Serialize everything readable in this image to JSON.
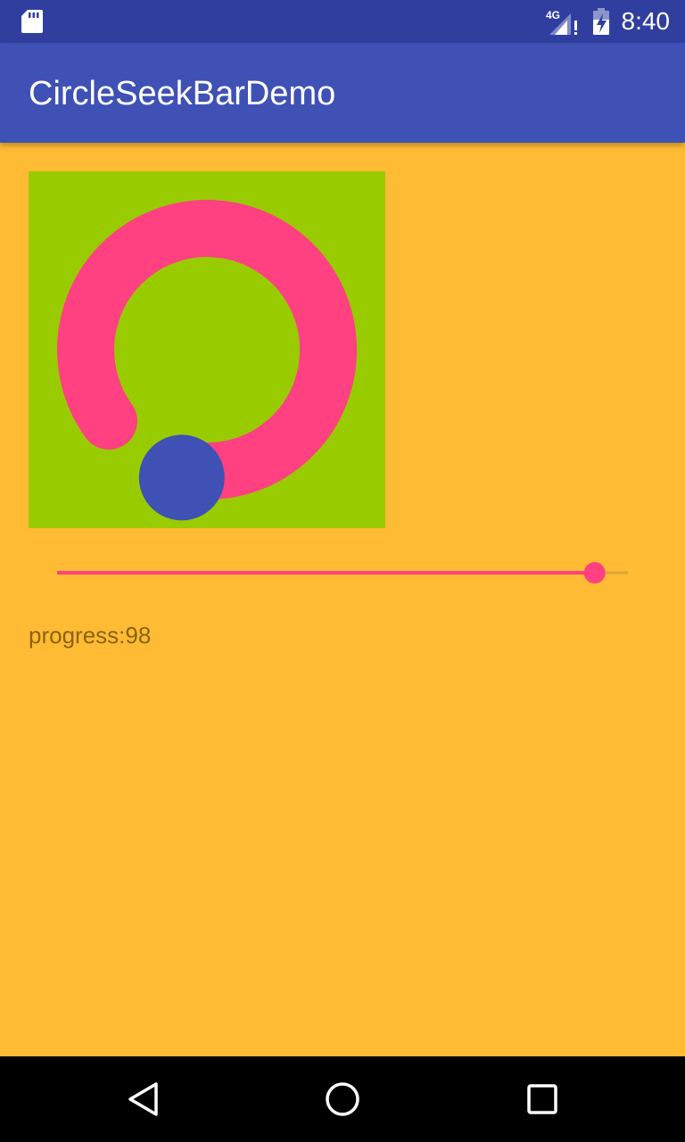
{
  "status_bar": {
    "time": "8:40",
    "network": "4G",
    "icons": [
      "sd-card-icon",
      "cellular-signal-icon",
      "battery-icon"
    ]
  },
  "app_bar": {
    "title": "CircleSeekBarDemo"
  },
  "circle_seekbar": {
    "progress": 98,
    "max": 100,
    "colors": {
      "background": "#99CC00",
      "arc": "#FF4081",
      "thumb": "#3F51B5"
    }
  },
  "seek_bar": {
    "progress": 98,
    "max": 100,
    "colors": {
      "progress": "#FF4081",
      "track": "#D4A83A",
      "thumb": "#FF4081"
    }
  },
  "progress_label": "progress:98",
  "colors": {
    "status_bar": "#303F9F",
    "app_bar": "#3F51B5",
    "background": "#FFBB33"
  },
  "nav_bar": {
    "icons": [
      "back-icon",
      "home-icon",
      "recents-icon"
    ]
  }
}
